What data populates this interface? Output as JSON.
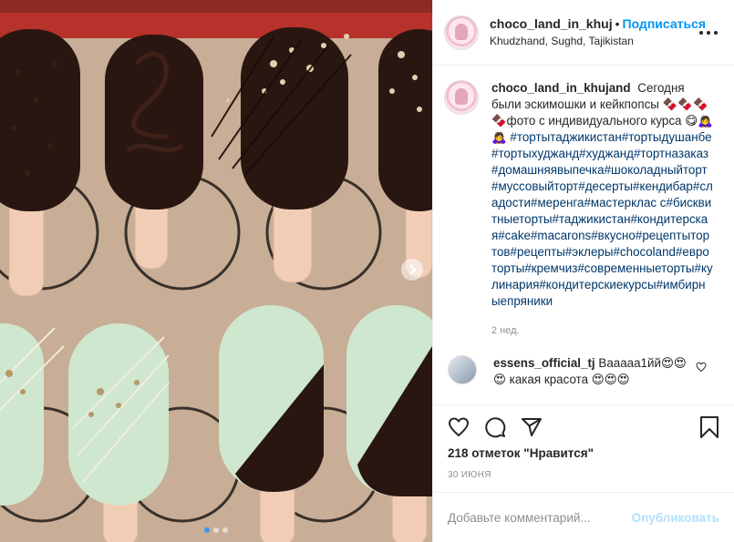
{
  "post": {
    "username": "choco_land_in_khuj",
    "separator": "•",
    "follow_label": "Подписаться",
    "location": "Khudzhand, Sughd, Tajikistan",
    "more_icon": "more-horizontal-icon"
  },
  "caption": {
    "username": "choco_land_in_khujand",
    "text": "Сегодня были эскимошки и кейкпопсы 🍫🍫🍫🍫фото с индивидуального курса 😋🙇‍♀️🙇‍♀️",
    "hashtags": "#тортытаджикистан#тортыдушанбе#тортыхуджанд#худжанд#тортназаказ#домашняявыпечка#шоколадныйторт#муссовыйторт#десерты#кендибар#сладости#меренга#мастерклас с#бисквитныеторты#таджикистан#кондитерская#cake#macarons#вкусно#рецептытортов#рецепты#эклеры#chocoland#евроторты#кремчиз#современныеторты#кулинария#кондитерскиекурсы#имбирныепряники",
    "time_ago": "2 нед."
  },
  "comment": {
    "username": "essens_official_tj",
    "text": "Вааааа1йй😍😍😍 какая красота 😍😍😍"
  },
  "actions": {
    "like_icon": "heart-icon",
    "comment_icon": "comment-icon",
    "share_icon": "share-icon",
    "save_icon": "bookmark-icon"
  },
  "likes_text": "218 отметок \"Нравится\"",
  "date": "30 ИЮНЯ",
  "add_comment": {
    "placeholder": "Добавьте комментарий...",
    "publish_label": "Опубликовать"
  },
  "colors": {
    "link_blue": "#0095f6",
    "hashtag": "#00376b",
    "muted": "#8e8e8e",
    "publish_disabled": "#b2dffc",
    "chocolate": "#2b1712",
    "pistachio": "#cfe6cf",
    "stick": "#f2cdb5"
  }
}
